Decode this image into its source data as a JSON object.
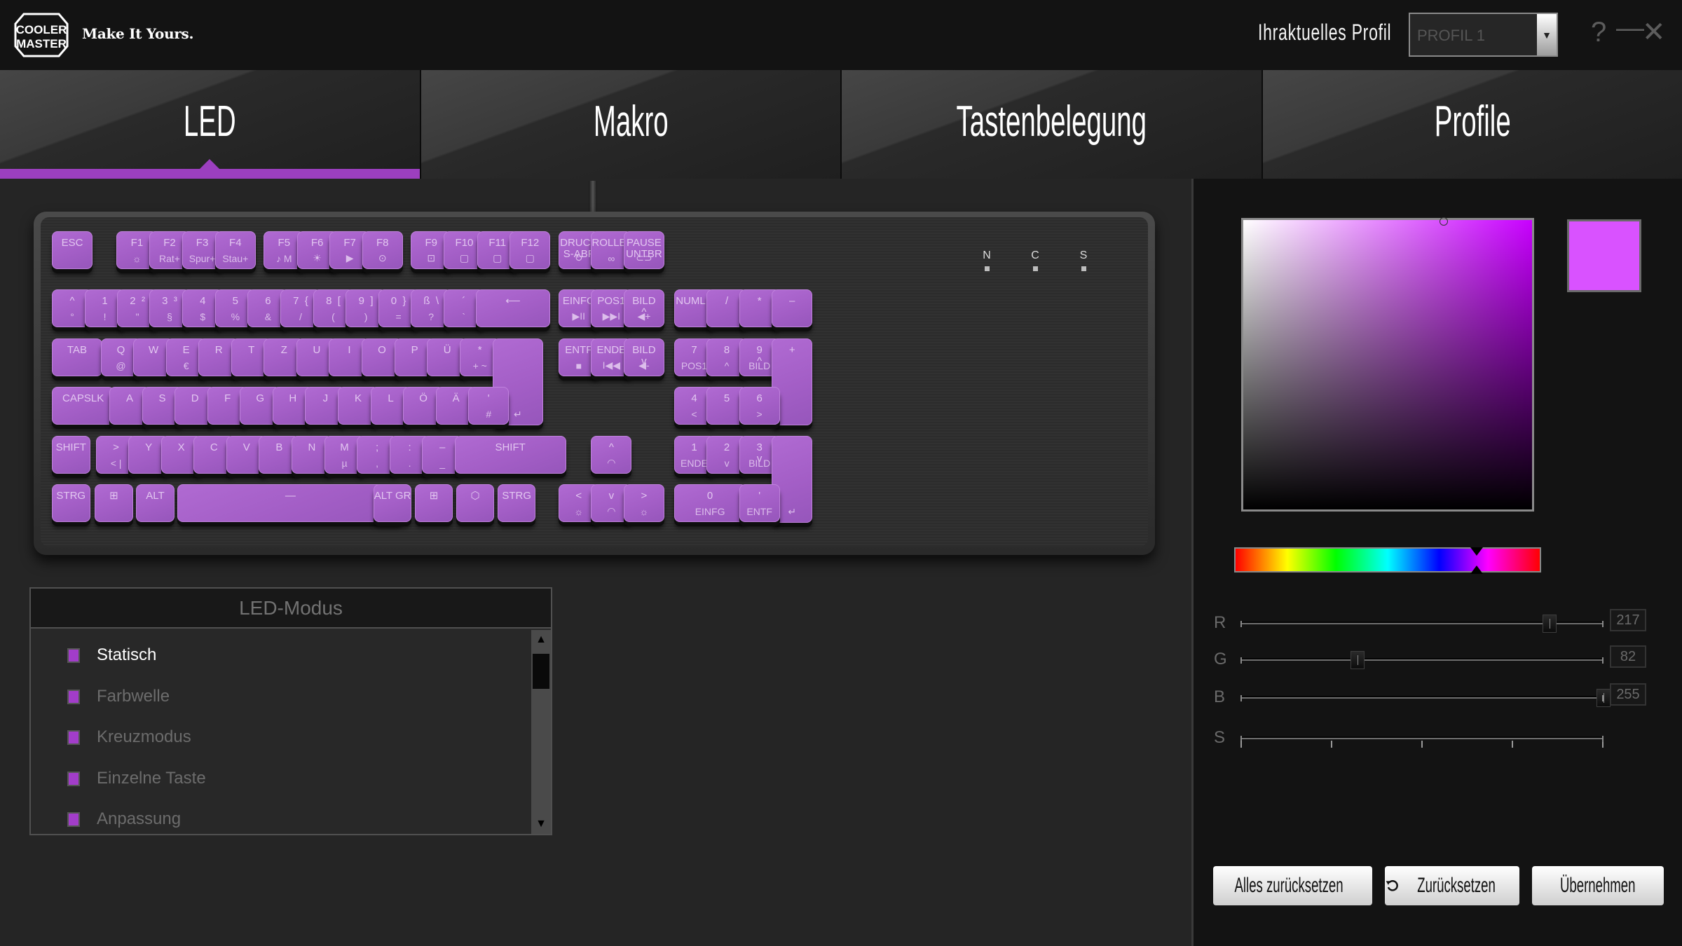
{
  "header": {
    "brand": "COOLER MASTER",
    "tagline": "Make It Yours.",
    "profile_label": "Ihraktuelles Profil",
    "profile_value": "PROFIL 1",
    "help_icon": "?",
    "minimize_icon": "—",
    "close_icon": "✕"
  },
  "tabs": [
    {
      "label": "LED",
      "active": true
    },
    {
      "label": "Makro",
      "active": false
    },
    {
      "label": "Tastenbelegung",
      "active": false
    },
    {
      "label": "Profile",
      "active": false
    }
  ],
  "keyboard": {
    "led_color": "#a35ec6",
    "lock_indicators": [
      "N",
      "C",
      "S"
    ],
    "rows": {
      "fn": [
        {
          "k1": "ESC",
          "k2": ""
        },
        {
          "k1": "F1",
          "k2": "☼"
        },
        {
          "k1": "F2",
          "k2": "Rat+"
        },
        {
          "k1": "F3",
          "k2": "Spur+"
        },
        {
          "k1": "F4",
          "k2": "Stau+"
        },
        {
          "k1": "F5",
          "k2": "♪ M"
        },
        {
          "k1": "F6",
          "k2": "☀"
        },
        {
          "k1": "F7",
          "k2": "▶"
        },
        {
          "k1": "F8",
          "k2": "⊙"
        },
        {
          "k1": "F9",
          "k2": "⊡"
        },
        {
          "k1": "F10",
          "k2": "▢"
        },
        {
          "k1": "F11",
          "k2": "▢"
        },
        {
          "k1": "F12",
          "k2": "▢"
        },
        {
          "k1": "DRUCK\nS-ABF",
          "k2": "↻"
        },
        {
          "k1": "ROLLEN",
          "k2": "∞"
        },
        {
          "k1": "PAUSE\nUNTBR",
          "k2": "⊂⊃"
        }
      ],
      "num": [
        {
          "k1": "^",
          "k2": "°"
        },
        {
          "k1": "1",
          "k2": "!"
        },
        {
          "k1": "2  ²",
          "k2": "\""
        },
        {
          "k1": "3  ³",
          "k2": "§"
        },
        {
          "k1": "4",
          "k2": "$"
        },
        {
          "k1": "5",
          "k2": "%"
        },
        {
          "k1": "6",
          "k2": "&"
        },
        {
          "k1": "7  {",
          "k2": "/"
        },
        {
          "k1": "8  [",
          "k2": "("
        },
        {
          "k1": "9  ]",
          "k2": ")"
        },
        {
          "k1": "0  }",
          "k2": "="
        },
        {
          "k1": "ß  \\",
          "k2": "?"
        },
        {
          "k1": "´",
          "k2": "`"
        },
        {
          "k1": "⟵",
          "k2": ""
        },
        {
          "k1": "EINFG",
          "k2": "▶II"
        },
        {
          "k1": "POS1",
          "k2": "▶▶I"
        },
        {
          "k1": "BILD\n^",
          "k2": "◀+"
        },
        {
          "k1": "NUMLK",
          "k2": ""
        },
        {
          "k1": "/",
          "k2": ""
        },
        {
          "k1": "*",
          "k2": ""
        },
        {
          "k1": "–",
          "k2": ""
        }
      ],
      "qwertz": [
        {
          "k1": "TAB",
          "k2": ""
        },
        {
          "k1": "Q",
          "k2": "@"
        },
        {
          "k1": "W",
          "k2": ""
        },
        {
          "k1": "E",
          "k2": "€"
        },
        {
          "k1": "R",
          "k2": ""
        },
        {
          "k1": "T",
          "k2": ""
        },
        {
          "k1": "Z",
          "k2": ""
        },
        {
          "k1": "U",
          "k2": ""
        },
        {
          "k1": "I",
          "k2": ""
        },
        {
          "k1": "O",
          "k2": ""
        },
        {
          "k1": "P",
          "k2": ""
        },
        {
          "k1": "Ü",
          "k2": ""
        },
        {
          "k1": "*",
          "k2": "+  ~"
        },
        {
          "k1": "",
          "k2": "↵"
        },
        {
          "k1": "ENTF",
          "k2": "■"
        },
        {
          "k1": "ENDE",
          "k2": "I◀◀"
        },
        {
          "k1": "BILD\nv",
          "k2": "◀-"
        },
        {
          "k1": "7",
          "k2": "POS1"
        },
        {
          "k1": "8",
          "k2": "^"
        },
        {
          "k1": "9\n^",
          "k2": "BILD"
        },
        {
          "k1": "+",
          "k2": ""
        }
      ],
      "home": [
        {
          "k1": "CAPSLK",
          "k2": ""
        },
        {
          "k1": "A",
          "k2": ""
        },
        {
          "k1": "S",
          "k2": ""
        },
        {
          "k1": "D",
          "k2": ""
        },
        {
          "k1": "F",
          "k2": ""
        },
        {
          "k1": "G",
          "k2": ""
        },
        {
          "k1": "H",
          "k2": ""
        },
        {
          "k1": "J",
          "k2": ""
        },
        {
          "k1": "K",
          "k2": ""
        },
        {
          "k1": "L",
          "k2": ""
        },
        {
          "k1": "Ö",
          "k2": ""
        },
        {
          "k1": "Ä",
          "k2": ""
        },
        {
          "k1": "'",
          "k2": "#"
        },
        {
          "k1": "4",
          "k2": "<"
        },
        {
          "k1": "5",
          "k2": ""
        },
        {
          "k1": "6",
          "k2": ">"
        }
      ],
      "shift": [
        {
          "k1": "SHIFT",
          "k2": ""
        },
        {
          "k1": ">",
          "k2": "<  |"
        },
        {
          "k1": "Y",
          "k2": ""
        },
        {
          "k1": "X",
          "k2": ""
        },
        {
          "k1": "C",
          "k2": ""
        },
        {
          "k1": "V",
          "k2": ""
        },
        {
          "k1": "B",
          "k2": ""
        },
        {
          "k1": "N",
          "k2": ""
        },
        {
          "k1": "M",
          "k2": "µ"
        },
        {
          "k1": ";",
          "k2": ","
        },
        {
          "k1": ":",
          "k2": "."
        },
        {
          "k1": "–",
          "k2": "_"
        },
        {
          "k1": "SHIFT",
          "k2": ""
        },
        {
          "k1": "^",
          "k2": "◠"
        },
        {
          "k1": "1",
          "k2": "ENDE"
        },
        {
          "k1": "2",
          "k2": "v"
        },
        {
          "k1": "3\nv",
          "k2": "BILD"
        },
        {
          "k1": "",
          "k2": "↵"
        }
      ],
      "bottom": [
        {
          "k1": "STRG",
          "k2": ""
        },
        {
          "k1": "⊞",
          "k2": ""
        },
        {
          "k1": "ALT",
          "k2": ""
        },
        {
          "k1": "—",
          "k2": ""
        },
        {
          "k1": "ALT GR",
          "k2": ""
        },
        {
          "k1": "⊞",
          "k2": ""
        },
        {
          "k1": "⬡",
          "k2": ""
        },
        {
          "k1": "STRG",
          "k2": ""
        },
        {
          "k1": "<",
          "k2": "☼"
        },
        {
          "k1": "v",
          "k2": "◠"
        },
        {
          "k1": ">",
          "k2": "☼"
        },
        {
          "k1": "0",
          "k2": "EINFG"
        },
        {
          "k1": "'",
          "k2": "ENTF"
        }
      ]
    }
  },
  "led_mode": {
    "title": "LED-Modus",
    "items": [
      {
        "label": "Statisch",
        "active": true
      },
      {
        "label": "Farbwelle",
        "active": false
      },
      {
        "label": "Kreuzmodus",
        "active": false
      },
      {
        "label": "Einzelne Taste",
        "active": false
      },
      {
        "label": "Anpassung",
        "active": false
      }
    ]
  },
  "color": {
    "current_hex": "#d952ff",
    "hue_degrees": 285,
    "rgb": {
      "R": {
        "label": "R",
        "value": "217",
        "fraction": 0.851
      },
      "G": {
        "label": "G",
        "value": "82",
        "fraction": 0.322
      },
      "B": {
        "label": "B",
        "value": "255",
        "fraction": 1.0
      }
    },
    "S": {
      "label": "S",
      "ticks": 5
    }
  },
  "buttons": {
    "reset_all": "Alles zurücksetzen",
    "reset": "Zurücksetzen",
    "apply": "Übernehmen"
  }
}
